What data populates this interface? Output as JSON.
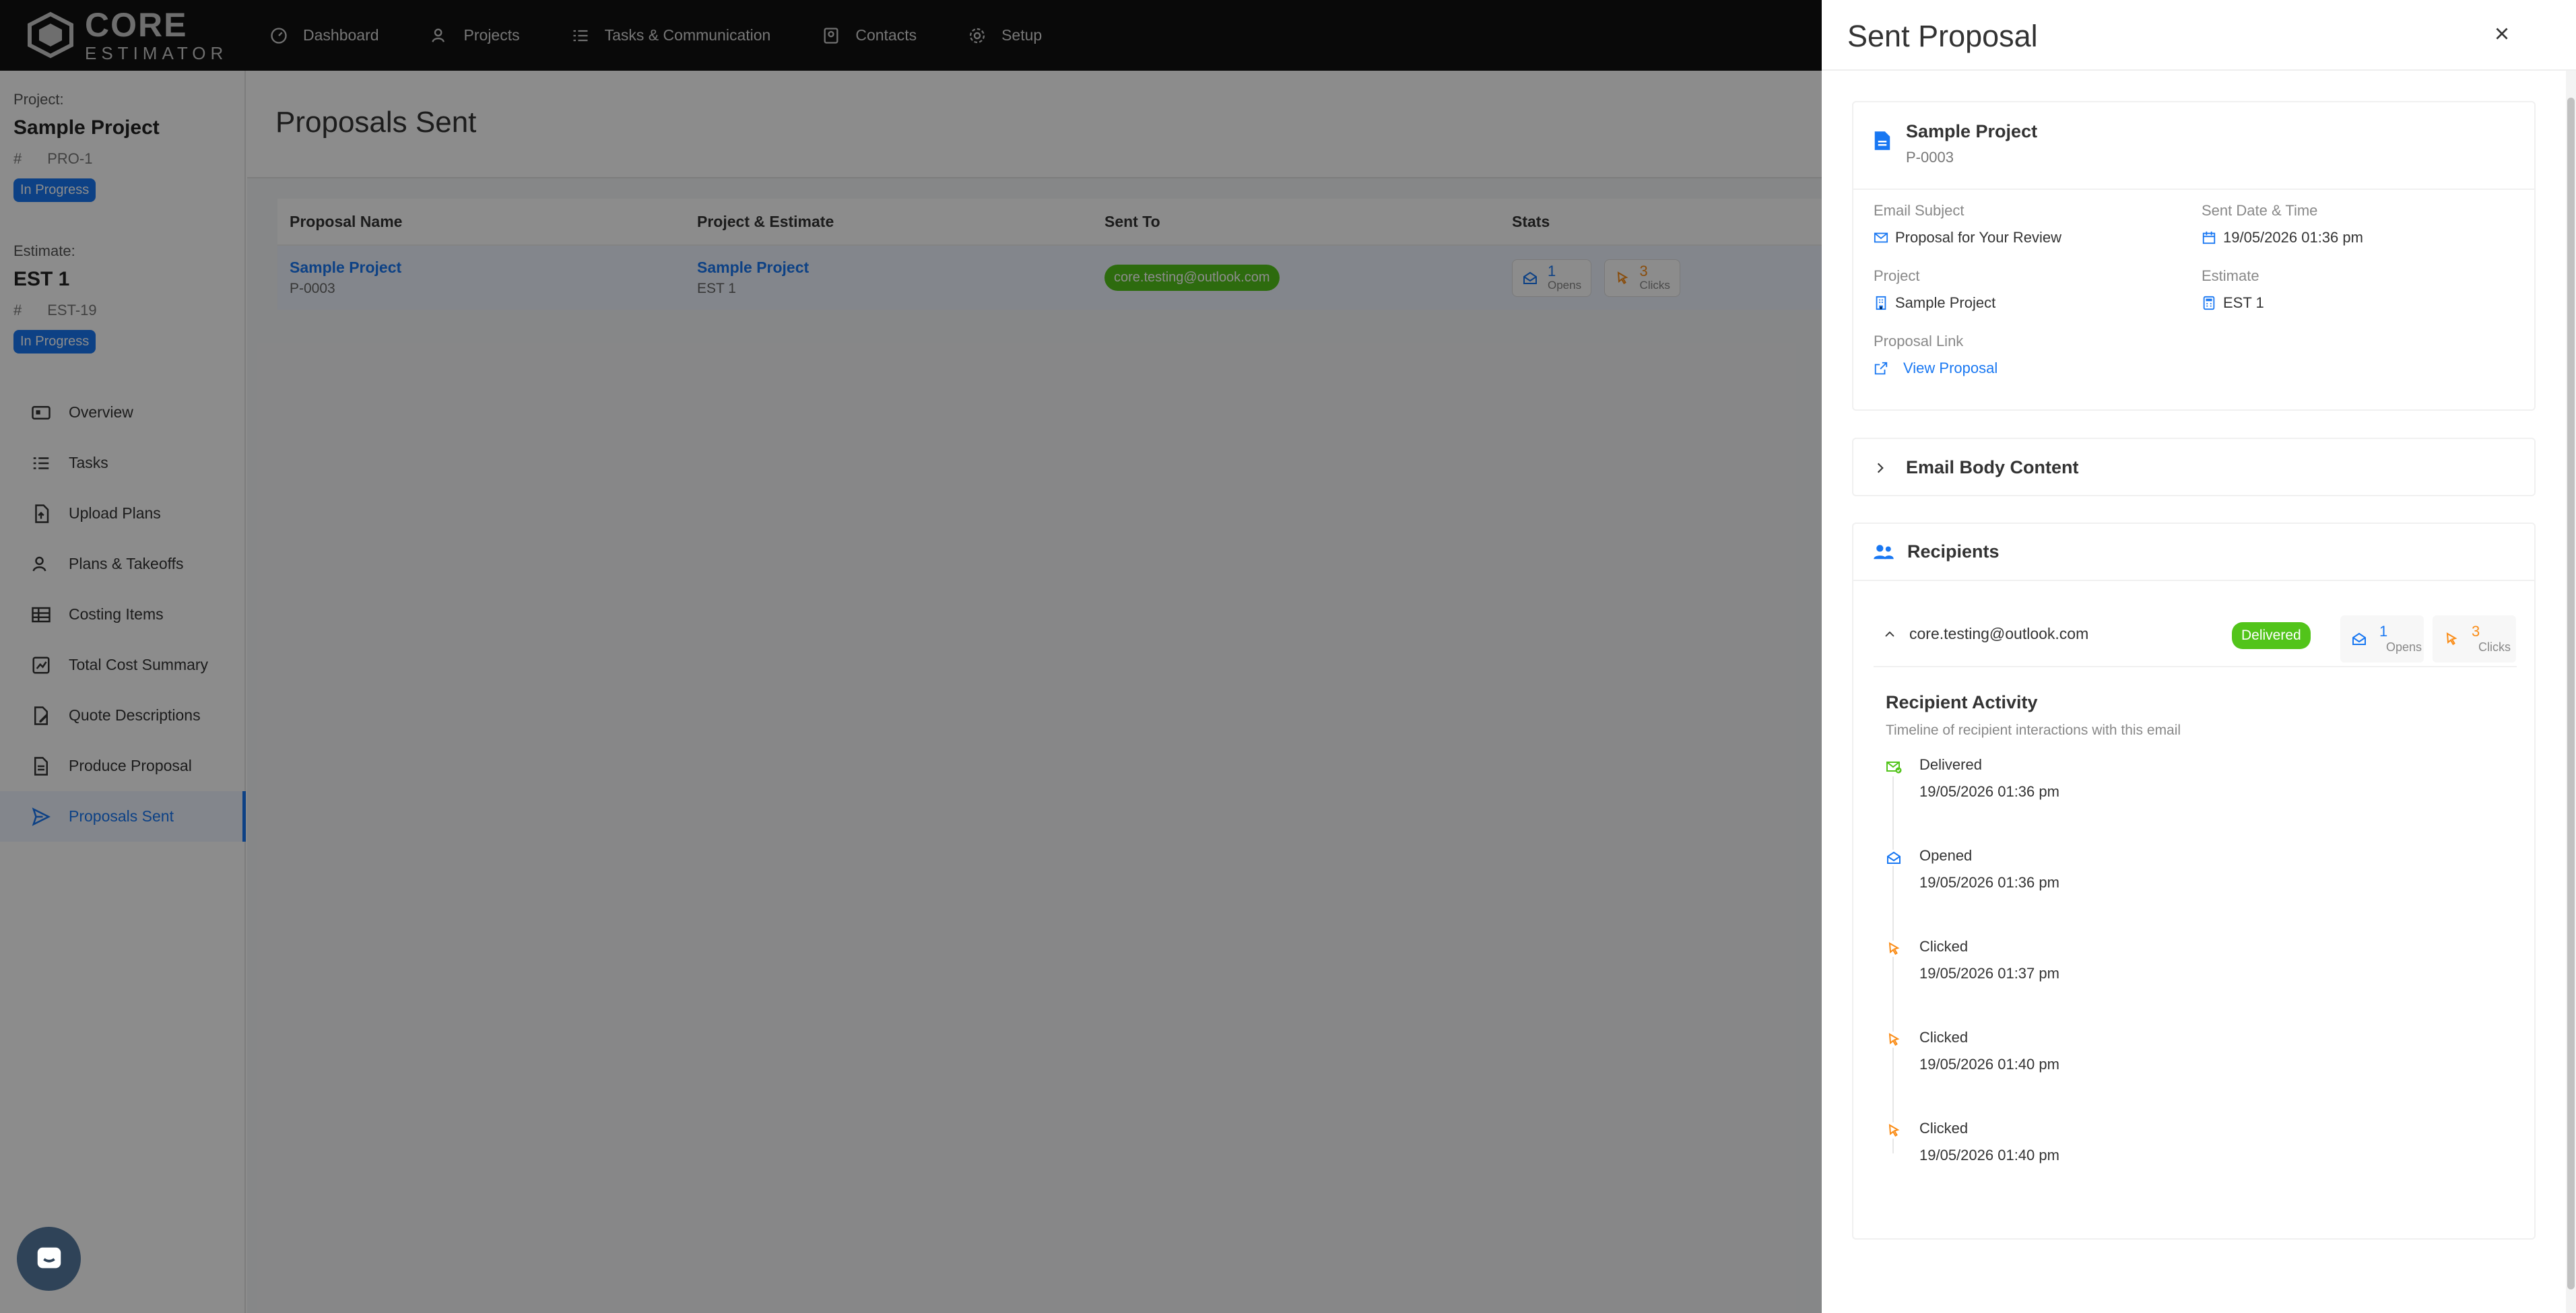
{
  "brand": {
    "line1": "CORE",
    "line2": "ESTIMATOR"
  },
  "nav": {
    "dashboard": "Dashboard",
    "projects": "Projects",
    "tasks": "Tasks & Communication",
    "contacts": "Contacts",
    "setup": "Setup"
  },
  "sidebar": {
    "project_label": "Project:",
    "project_name": "Sample Project",
    "project_hash": "#",
    "project_code": "PRO-1",
    "project_status": "In Progress",
    "estimate_label": "Estimate:",
    "estimate_name": "EST 1",
    "estimate_hash": "#",
    "estimate_code": "EST-19",
    "estimate_status": "In Progress",
    "items": [
      {
        "label": "Overview",
        "icon": "overview-icon"
      },
      {
        "label": "Tasks",
        "icon": "tasks-icon"
      },
      {
        "label": "Upload Plans",
        "icon": "upload-icon"
      },
      {
        "label": "Plans & Takeoffs",
        "icon": "takeoffs-icon"
      },
      {
        "label": "Costing Items",
        "icon": "costing-icon"
      },
      {
        "label": "Total Cost Summary",
        "icon": "summary-icon"
      },
      {
        "label": "Quote Descriptions",
        "icon": "quote-icon"
      },
      {
        "label": "Produce Proposal",
        "icon": "proposal-icon"
      },
      {
        "label": "Proposals Sent",
        "icon": "send-icon",
        "active": true
      }
    ]
  },
  "main": {
    "title": "Proposals Sent",
    "headers": [
      "Proposal Name",
      "Project & Estimate",
      "Sent To",
      "Stats"
    ],
    "row": {
      "proposal_name": "Sample Project",
      "proposal_code": "P-0003",
      "project": "Sample Project",
      "estimate": "EST 1",
      "sent_to": "core.testing@outlook.com",
      "opens": "1",
      "opens_label": "Opens",
      "clicks": "3",
      "clicks_label": "Clicks"
    }
  },
  "drawer": {
    "title": "Sent Proposal",
    "proposal": {
      "name": "Sample Project",
      "code": "P-0003"
    },
    "fields": {
      "email_subject_label": "Email Subject",
      "email_subject": "Proposal for Your Review",
      "sent_label": "Sent Date & Time",
      "sent": "19/05/2026 01:36 pm",
      "project_label": "Project",
      "project": "Sample Project",
      "estimate_label": "Estimate",
      "estimate": "EST 1",
      "link_label": "Proposal Link",
      "link": "View Proposal"
    },
    "email_body_label": "Email Body Content",
    "recipients_label": "Recipients",
    "recipient": {
      "email": "core.testing@outlook.com",
      "status": "Delivered",
      "opens": "1",
      "opens_label": "Opens",
      "clicks": "3",
      "clicks_label": "Clicks"
    },
    "activity": {
      "title": "Recipient Activity",
      "subtitle": "Timeline of recipient interactions with this email",
      "events": [
        {
          "status": "Delivered",
          "time": "19/05/2026 01:36 pm",
          "icon": "delivered-icon"
        },
        {
          "status": "Opened",
          "time": "19/05/2026 01:36 pm",
          "icon": "opened-icon"
        },
        {
          "status": "Clicked",
          "time": "19/05/2026 01:37 pm",
          "icon": "click-icon"
        },
        {
          "status": "Clicked",
          "time": "19/05/2026 01:40 pm",
          "icon": "click-icon"
        },
        {
          "status": "Clicked",
          "time": "19/05/2026 01:40 pm",
          "icon": "click-icon"
        }
      ]
    }
  },
  "colors": {
    "accent": "#1877f2",
    "success": "#52c41a",
    "warning": "#fa8c16",
    "nav_bg": "#111111"
  }
}
